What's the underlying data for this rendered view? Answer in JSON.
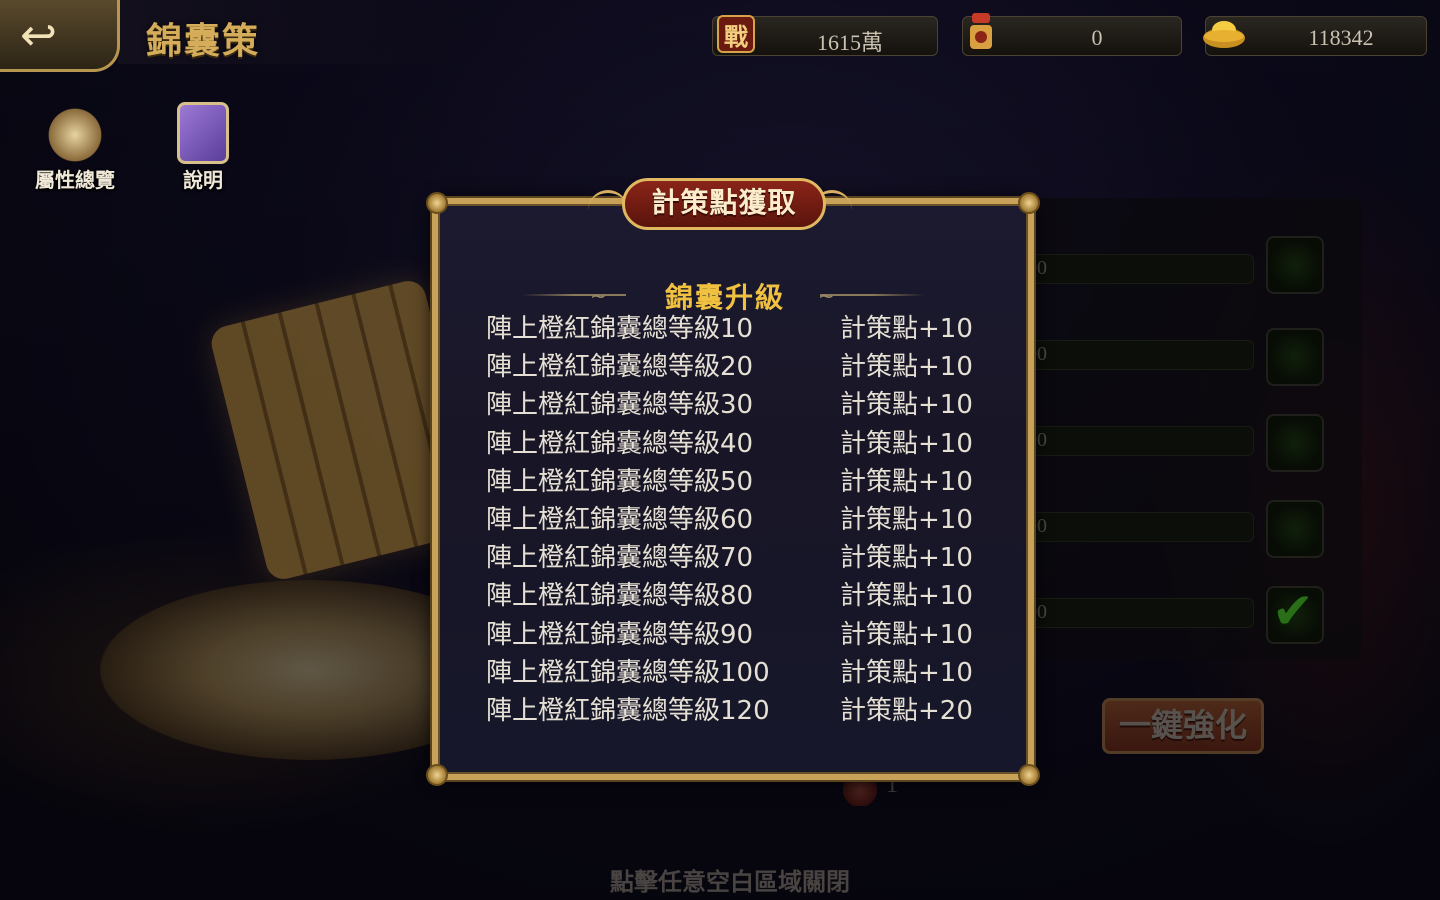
{
  "header": {
    "title": "錦囊策",
    "back_icon": "back-arrow-icon"
  },
  "resources": {
    "power_glyph": "戰",
    "power_value": "1615萬",
    "tokens_value": "0",
    "gold_value": "118342"
  },
  "side_menu": {
    "attributes_label": "屬性總覽",
    "help_label": "說明"
  },
  "background": {
    "slot_values": [
      "00",
      "00",
      "00",
      "00",
      "00"
    ],
    "slot_checked": [
      false,
      false,
      false,
      false,
      true
    ],
    "one_key_label": "一鍵強化",
    "cost_value": "1",
    "close_hint": "點擊任意空白區域關閉"
  },
  "dialog": {
    "title": "計策點獲取",
    "section_title": "錦囊升級",
    "rows": [
      {
        "condition": "陣上橙紅錦囊總等級10",
        "reward": "計策點+10"
      },
      {
        "condition": "陣上橙紅錦囊總等級20",
        "reward": "計策點+10"
      },
      {
        "condition": "陣上橙紅錦囊總等級30",
        "reward": "計策點+10"
      },
      {
        "condition": "陣上橙紅錦囊總等級40",
        "reward": "計策點+10"
      },
      {
        "condition": "陣上橙紅錦囊總等級50",
        "reward": "計策點+10"
      },
      {
        "condition": "陣上橙紅錦囊總等級60",
        "reward": "計策點+10"
      },
      {
        "condition": "陣上橙紅錦囊總等級70",
        "reward": "計策點+10"
      },
      {
        "condition": "陣上橙紅錦囊總等級80",
        "reward": "計策點+10"
      },
      {
        "condition": "陣上橙紅錦囊總等級90",
        "reward": "計策點+10"
      },
      {
        "condition": "陣上橙紅錦囊總等級100",
        "reward": "計策點+10"
      },
      {
        "condition": "陣上橙紅錦囊總等級120",
        "reward": "計策點+20"
      }
    ]
  },
  "colors": {
    "gold_border": "#c9a25a",
    "header_red": "#8a2418",
    "section_title": "#f0c040",
    "check_green": "#4ec82a"
  }
}
